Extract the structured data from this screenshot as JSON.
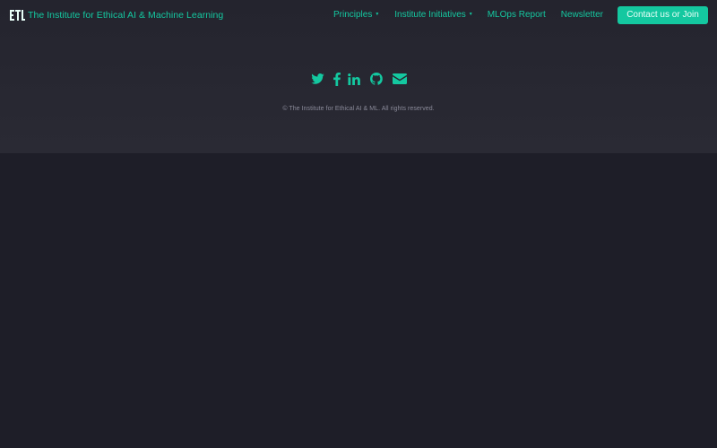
{
  "navbar": {
    "brand_name": "The Institute for Ethical AI & Machine Learning",
    "links": [
      {
        "label": "Principles",
        "has_dropdown": true
      },
      {
        "label": "Institute Initiatives",
        "has_dropdown": true
      },
      {
        "label": "MLOps Report",
        "has_dropdown": false
      },
      {
        "label": "Newsletter",
        "has_dropdown": false
      }
    ],
    "dropdown_caret": "▼",
    "cta_label": "Contact us or Join"
  },
  "footer": {
    "social_icons": [
      "twitter-icon",
      "facebook-icon",
      "linkedin-icon",
      "github-icon",
      "envelope-icon"
    ],
    "copyright": "© The Institute for Ethical AI & ML. All rights reserved."
  },
  "colors": {
    "accent": "#14c8a0",
    "panel_bg": "#2a2a34",
    "page_bg": "#1e1e28",
    "muted_text": "#8a8a99"
  }
}
